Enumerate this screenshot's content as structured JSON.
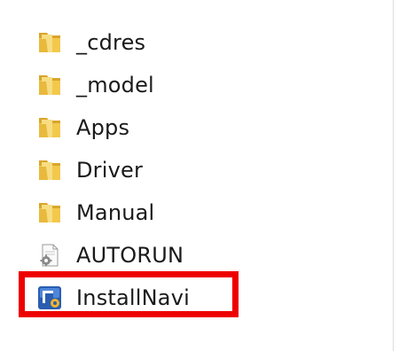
{
  "files": [
    {
      "name": "_cdres",
      "icon": "folder-icon"
    },
    {
      "name": "_model",
      "icon": "folder-icon"
    },
    {
      "name": "Apps",
      "icon": "folder-icon"
    },
    {
      "name": "Driver",
      "icon": "folder-icon"
    },
    {
      "name": "Manual",
      "icon": "folder-icon"
    },
    {
      "name": "AUTORUN",
      "icon": "settings-file-icon"
    },
    {
      "name": "InstallNavi",
      "icon": "installer-app-icon"
    }
  ],
  "highlight": {
    "target": "InstallNavi",
    "color": "#ee0000"
  },
  "colors": {
    "folder": "#e8b93c",
    "folder_light": "#f7dd82",
    "app_icon": "#2a5db0"
  }
}
